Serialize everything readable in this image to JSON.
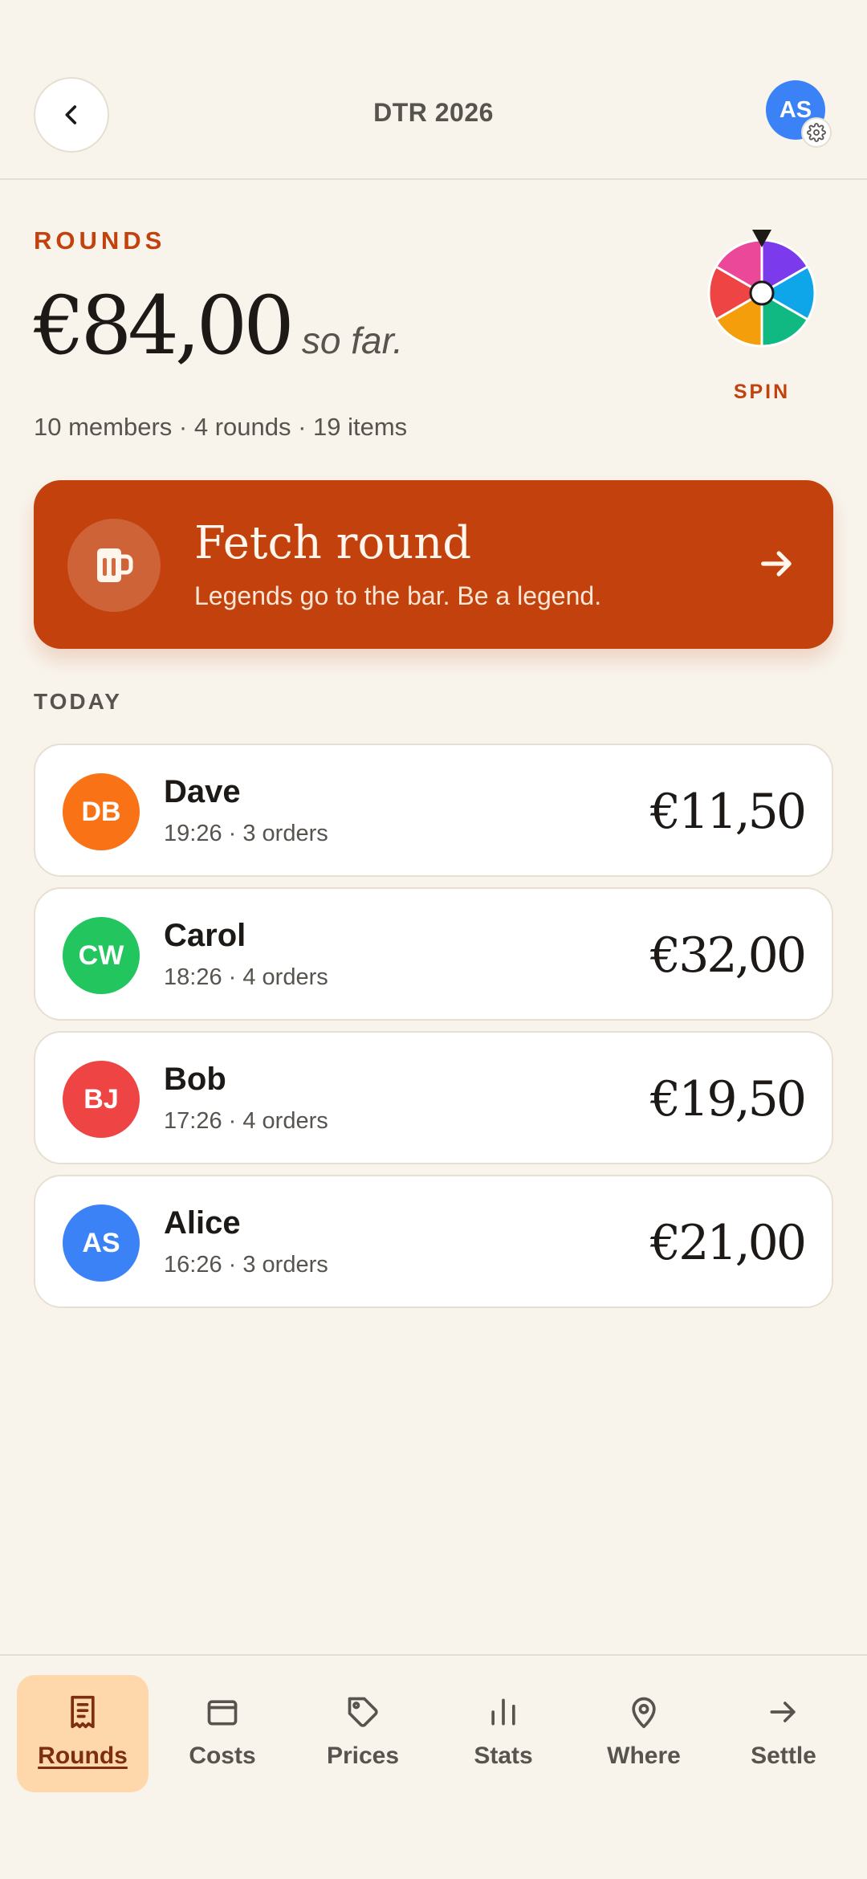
{
  "header": {
    "title": "DTR 2026",
    "avatar_initials": "AS",
    "avatar_color": "#3B82F6"
  },
  "summary": {
    "label": "ROUNDS",
    "total": "€84,00",
    "suffix": "so far.",
    "meta": "10 members · 4 rounds · 19 items",
    "spin_label": "SPIN"
  },
  "cta": {
    "title": "Fetch round",
    "subtitle": "Legends go to the bar. Be a legend.",
    "color": "#C2410C"
  },
  "today": {
    "label": "TODAY",
    "rounds": [
      {
        "initials": "DB",
        "name": "Dave",
        "meta": "19:26 · 3 orders",
        "amount": "€11,50",
        "color": "#F97316"
      },
      {
        "initials": "CW",
        "name": "Carol",
        "meta": "18:26 · 4 orders",
        "amount": "€32,00",
        "color": "#22C55E"
      },
      {
        "initials": "BJ",
        "name": "Bob",
        "meta": "17:26 · 4 orders",
        "amount": "€19,50",
        "color": "#EF4444"
      },
      {
        "initials": "AS",
        "name": "Alice",
        "meta": "16:26 · 3 orders",
        "amount": "€21,00",
        "color": "#3B82F6"
      }
    ]
  },
  "nav": {
    "items": [
      {
        "label": "Rounds",
        "icon": "receipt-icon",
        "active": true
      },
      {
        "label": "Costs",
        "icon": "wallet-icon",
        "active": false
      },
      {
        "label": "Prices",
        "icon": "tag-icon",
        "active": false
      },
      {
        "label": "Stats",
        "icon": "bar-chart-icon",
        "active": false
      },
      {
        "label": "Where",
        "icon": "map-pin-icon",
        "active": false
      },
      {
        "label": "Settle",
        "icon": "arrow-right-icon",
        "active": false
      }
    ]
  }
}
